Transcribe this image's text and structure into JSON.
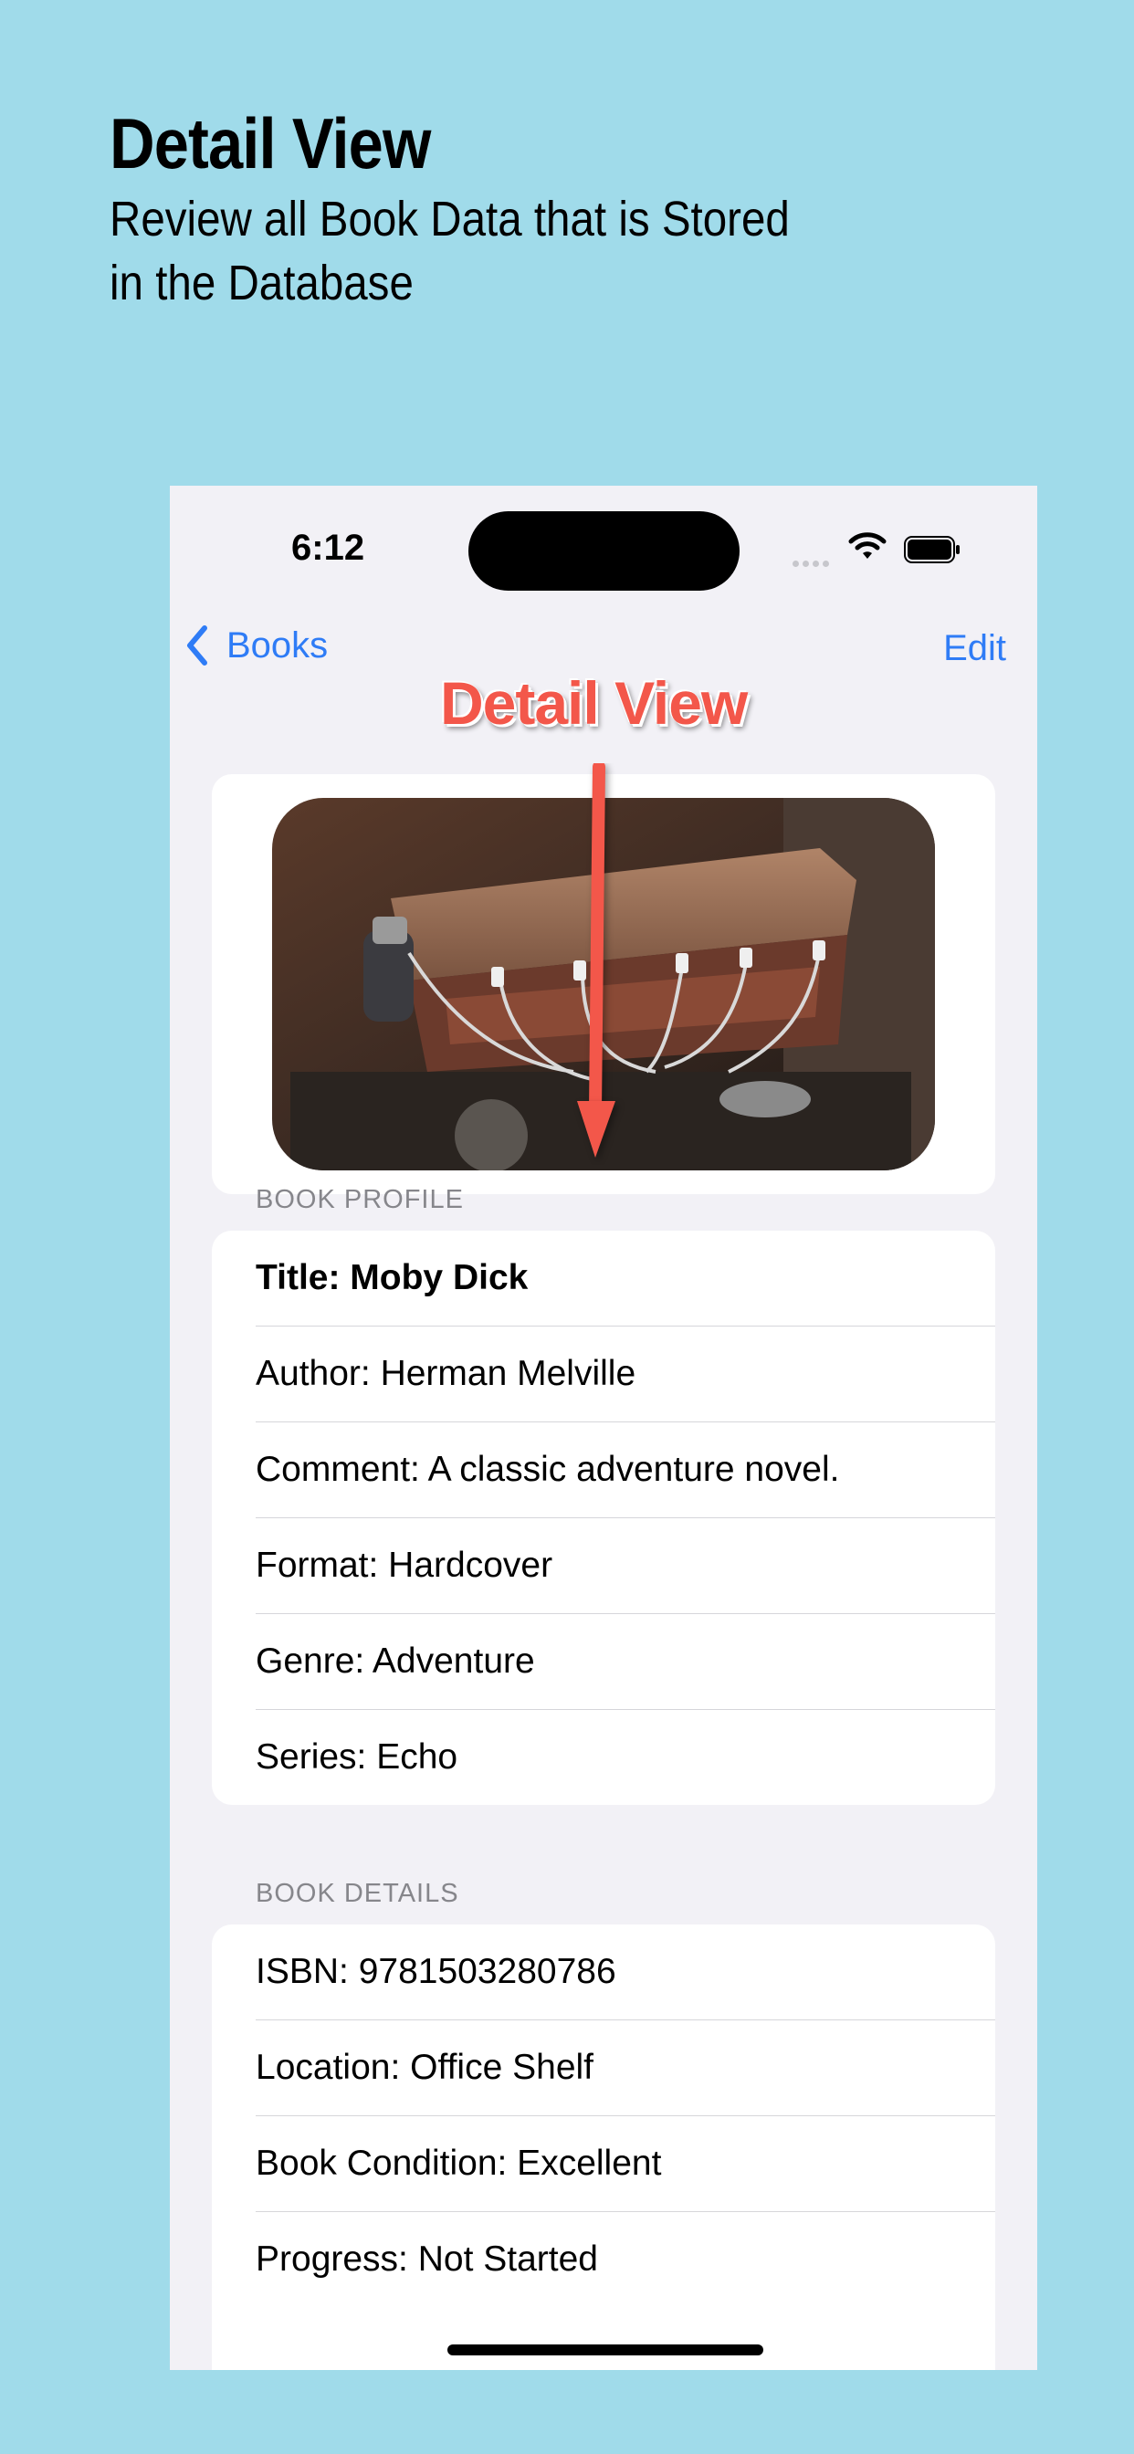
{
  "promo": {
    "title": "Detail View",
    "subtitle": "Review all Book Data that is Stored in the Database"
  },
  "status_bar": {
    "time": "6:12"
  },
  "nav": {
    "back_label": "Books",
    "edit_label": "Edit"
  },
  "annotation": {
    "label": "Detail View",
    "color": "#f3574a"
  },
  "book_profile": {
    "header": "BOOK PROFILE",
    "rows": [
      "Title: Moby Dick",
      "Author: Herman Melville",
      "Comment: A classic adventure novel.",
      "Format: Hardcover",
      "Genre: Adventure",
      "Series: Echo"
    ]
  },
  "book_details": {
    "header": "BOOK DETAILS",
    "rows": [
      "ISBN: 9781503280786",
      "Location: Office Shelf",
      "Book Condition: Excellent",
      "Progress: Not Started"
    ]
  },
  "colors": {
    "background": "#a0dbea",
    "accent": "#2f7cf6",
    "screen": "#f2f1f6"
  }
}
